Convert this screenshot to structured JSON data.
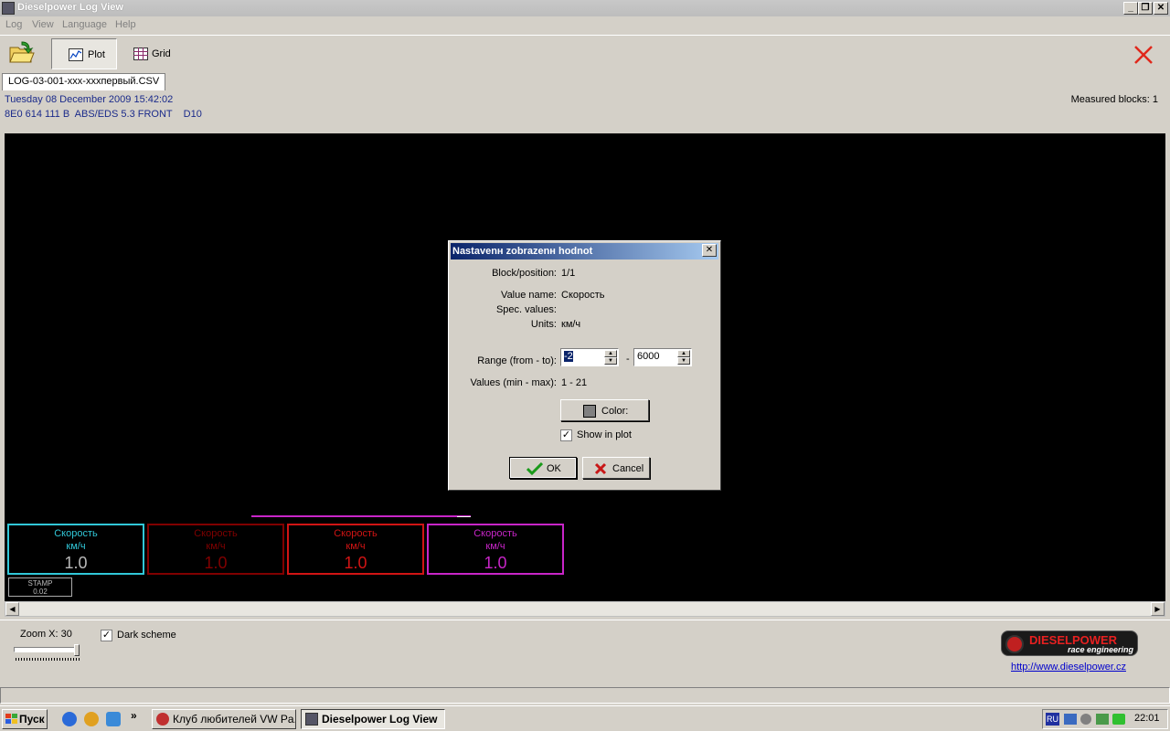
{
  "window": {
    "title": "Dieselpower Log View"
  },
  "menu": [
    "Log",
    "View",
    "Language",
    "Help"
  ],
  "toolbar": {
    "plot_label": "Plot",
    "grid_label": "Grid"
  },
  "tab": {
    "label": "LOG-03-001-xxx-xxxпервый.CSV"
  },
  "info": {
    "datetime": "Tuesday 08 December 2009 15:42:02",
    "module": "8E0 614 111 B  ABS/EDS 5.3 FRONT    D10",
    "measured_blocks": "Measured blocks: 1"
  },
  "gauges": [
    {
      "name": "Скорость",
      "unit": "км/ч",
      "value": "1.0",
      "color": "#31c7d8",
      "value_color": "#b9b9b9"
    },
    {
      "name": "Скорость",
      "unit": "км/ч",
      "value": "1.0",
      "color": "#800000",
      "value_color": "#800000"
    },
    {
      "name": "Скорость",
      "unit": "км/ч",
      "value": "1.0",
      "color": "#d11414",
      "value_color": "#d11414"
    },
    {
      "name": "Скорость",
      "unit": "км/ч",
      "value": "1.0",
      "color": "#c825c8",
      "value_color": "#c825c8"
    }
  ],
  "stamp": {
    "label": "STAMP",
    "value": "0.02"
  },
  "bottom": {
    "zoom_label": "Zoom X: 30",
    "zoom_level": 1.0,
    "dark_scheme_label": "Dark scheme",
    "dark_scheme_checked": true,
    "logo_title": "DIESELPOWER",
    "logo_subtitle": "race engineering",
    "website": "http://www.dieselpower.cz"
  },
  "dialog": {
    "title": "Nastavenн zobrazenн hodnot",
    "block_position_label": "Block/position:",
    "block_position_value": "1/1",
    "value_name_label": "Value name:",
    "value_name_value": "Скорость",
    "spec_values_label": "Spec. values:",
    "units_label": "Units:",
    "units_value": "км/ч",
    "range_label": "Range (from - to):",
    "range_from": "-2",
    "range_to": "6000",
    "range_sep": "-",
    "values_label": "Values (min - max):",
    "values_value": "1 - 21",
    "color_button_label": "Color:",
    "color_swatch": "#808080",
    "show_in_plot_label": "Show in plot",
    "show_in_plot_checked": true,
    "ok_label": "OK",
    "cancel_label": "Cancel"
  },
  "taskbar": {
    "start_label": "Пуск",
    "quicklaunch_more": "»",
    "tasks": [
      "Клуб любителей VW Pa...",
      "Dieselpower Log View"
    ],
    "tray_lang": "RU",
    "clock": "22:01"
  },
  "colors": {
    "titlebar_active": "#0a246a",
    "close_red": "#e0281c",
    "info_text": "#1a2a8a",
    "plot_background": "#000000"
  }
}
